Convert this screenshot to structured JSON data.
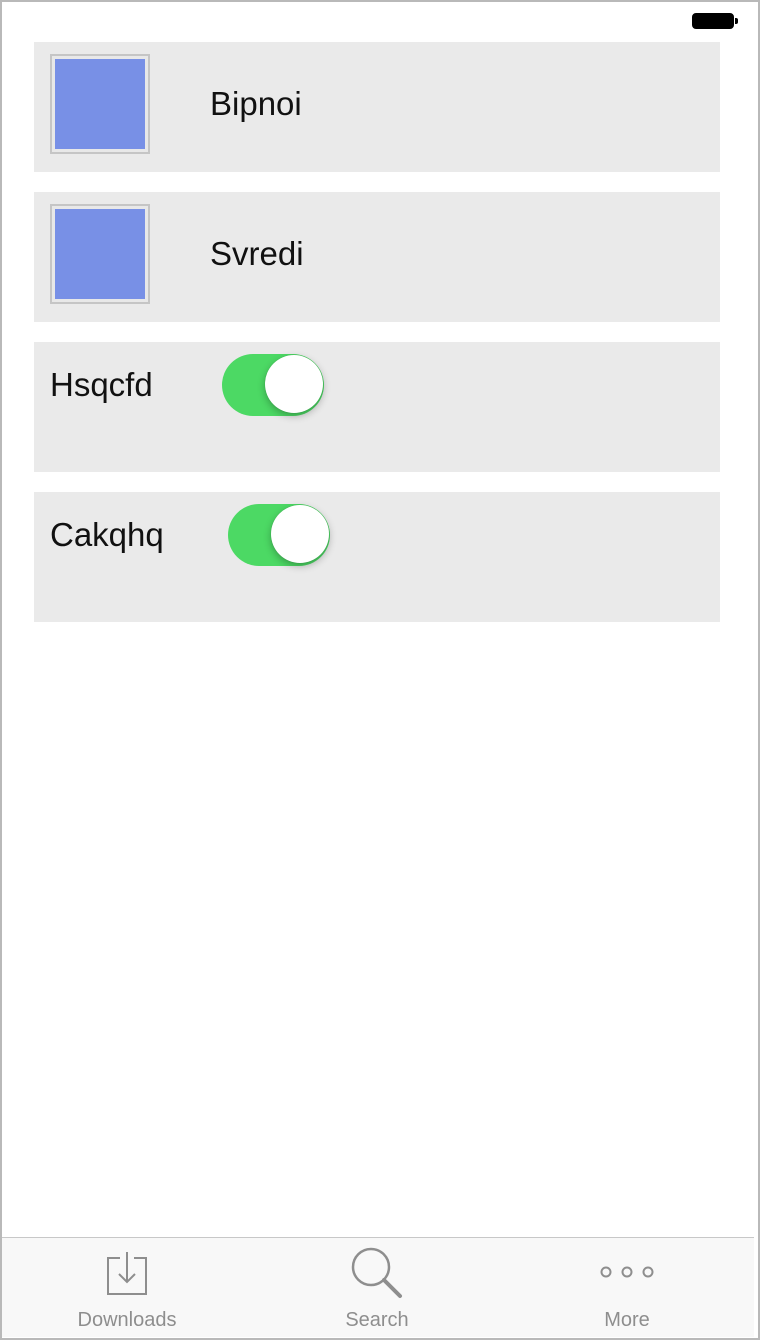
{
  "status_bar": {
    "battery_icon": "battery-full-icon"
  },
  "colors": {
    "image_fill": "#7890e6",
    "toggle_on": "#4cd964",
    "cell_bg": "#eaeaea",
    "tab_inactive": "#8e8e8e"
  },
  "list": {
    "image_cells": [
      {
        "label": "Bipnoi"
      },
      {
        "label": "Svredi"
      }
    ],
    "toggle_cells": [
      {
        "label": "Hsqcfd",
        "on": true
      },
      {
        "label": "Cakqhq",
        "on": true
      }
    ]
  },
  "tabbar": {
    "tabs": [
      {
        "label": "Downloads",
        "icon": "downloads-icon"
      },
      {
        "label": "Search",
        "icon": "search-icon"
      },
      {
        "label": "More",
        "icon": "more-icon"
      }
    ]
  }
}
